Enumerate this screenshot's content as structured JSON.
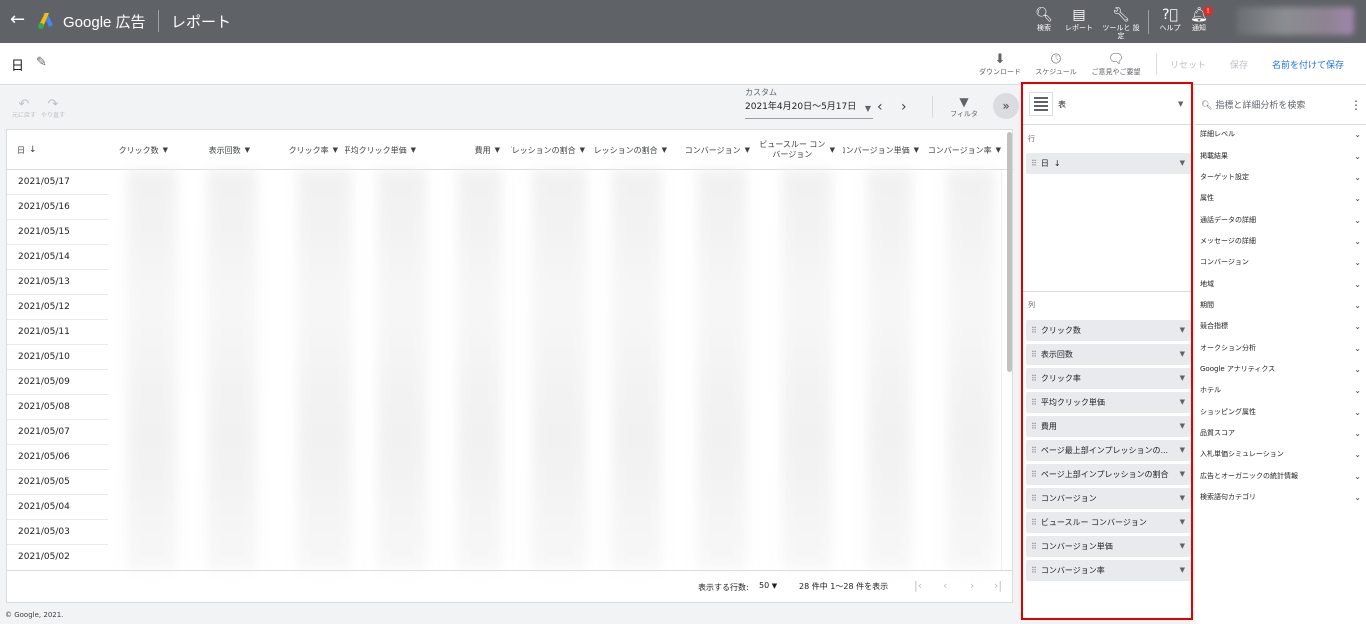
{
  "app": {
    "brand": "Google 広告",
    "page_title": "レポート",
    "top_icons": [
      {
        "icon": "search-icon",
        "label": "検索"
      },
      {
        "icon": "reports-icon",
        "label": "レポート"
      },
      {
        "icon": "wrench-icon",
        "label": "ツールと 設定"
      },
      {
        "icon": "help-icon",
        "label": "ヘルプ"
      },
      {
        "icon": "bell-icon",
        "label": "通知",
        "badge": "!"
      }
    ]
  },
  "subbar": {
    "report_name": "日",
    "download": "ダウンロード",
    "schedule": "スケジュール",
    "feedback": "ご意見やご要望",
    "reset": "リセット",
    "save": "保存",
    "save_as": "名前を付けて保存"
  },
  "toolbar": {
    "undo": "元に戻す",
    "redo": "やり直す",
    "date_label": "カスタム",
    "date_value": "2021年4月20日～5月17日",
    "filter": "フィルタ"
  },
  "table": {
    "date_header": "日",
    "columns": [
      "クリック数",
      "表示回数",
      "クリック率",
      "平均クリック単価",
      "費用",
      "インプレッションの割合",
      "インプレッションの割合",
      "コンバージョン",
      "ビュースルー コンバージョン",
      "コンバージョン単価",
      "コンバージョン率"
    ],
    "rows": [
      "2021/05/17",
      "2021/05/16",
      "2021/05/15",
      "2021/05/14",
      "2021/05/13",
      "2021/05/12",
      "2021/05/11",
      "2021/05/10",
      "2021/05/09",
      "2021/05/08",
      "2021/05/07",
      "2021/05/06",
      "2021/05/05",
      "2021/05/04",
      "2021/05/03",
      "2021/05/02"
    ],
    "rows_label": "表示する行数:",
    "rows_value": "50",
    "count_text": "28 件中 1～28 件を表示"
  },
  "editor": {
    "type_label": "表",
    "rows_label": "行",
    "row_chips": [
      "日"
    ],
    "cols_label": "列",
    "col_chips": [
      "クリック数",
      "表示回数",
      "クリック率",
      "平均クリック単価",
      "費用",
      "ページ最上部インプレッションの...",
      "ページ上部インプレッションの割合",
      "コンバージョン",
      "ビュースルー コンバージョン",
      "コンバージョン単価",
      "コンバージョン率"
    ]
  },
  "rpanel": {
    "search_placeholder": "指標と詳細分析を検索",
    "items": [
      "詳細レベル",
      "掲載結果",
      "ターゲット設定",
      "属性",
      "通話データの詳細",
      "メッセージの詳細",
      "コンバージョン",
      "地域",
      "期間",
      "競合指標",
      "オークション分析",
      "Google アナリティクス",
      "ホテル",
      "ショッピング属性",
      "品質スコア",
      "入札単価シミュレーション",
      "広告とオーガニックの統計情報",
      "検索語句カテゴリ"
    ]
  },
  "footer": {
    "copyright": "© Google, 2021."
  },
  "colors": {
    "topbar": "#5f6368",
    "accent": "#1a73e8",
    "highlight_border": "#e00000"
  }
}
